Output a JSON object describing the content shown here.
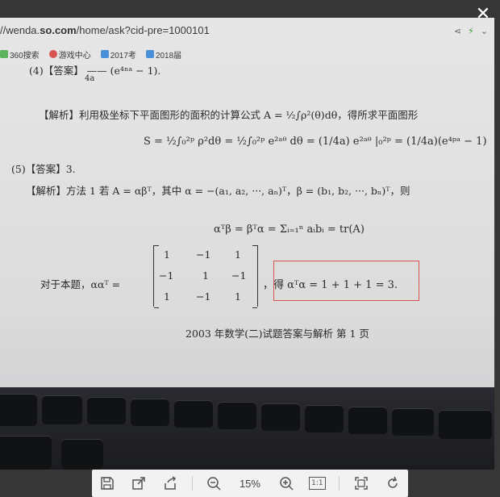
{
  "viewer": {
    "close_glyph": "✕",
    "zoom": "15%",
    "ratio_label": "1:1"
  },
  "browser": {
    "url_prefix": "//wenda.",
    "url_domain": "so.com",
    "url_path": "/home/ask?cid-pre=1000101",
    "bookmarks": [
      {
        "label": "360搜索",
        "color": "#5bb45b"
      },
      {
        "label": "游戏中心",
        "color": "#d9534f"
      },
      {
        "label": "2017考",
        "color": "#4a90d9"
      },
      {
        "label": "2018届",
        "color": "#4a90d9"
      }
    ]
  },
  "paper": {
    "line1": "(4)【答案】  —— (e⁴ⁿᵃ − 1).",
    "line1_frac": "4a",
    "line2": "【解析】利用极坐标下平面图形的面积的计算公式 A = ½∫ρ²(θ)dθ，得所求平面图形",
    "line3": "S = ½∫₀²ᵖ ρ²dθ = ½∫₀²ᵖ e²ᵃᶿ dθ = (1/4a) e²ᵃᶿ |₀²ᵖ = (1/4a)(e⁴ᵖᵃ − 1)",
    "line4": "(5)【答案】3.",
    "line5": "【解析】方法 1    若 A = αβᵀ，其中 α = −(a₁, a₂, ···, aₙ)ᵀ，β = (b₁, b₂, ···, bₙ)ᵀ，则",
    "line6": "αᵀβ = βᵀα = Σᵢ₌₁ⁿ aᵢbᵢ = tr(A)",
    "line7a": "对于本题，ααᵀ =",
    "matrix": [
      [
        "1",
        "−1",
        "1"
      ],
      [
        "−1",
        "1",
        "−1"
      ],
      [
        "1",
        "−1",
        "1"
      ]
    ],
    "line7b": "，得 αᵀα = 1 + 1 + 1 = 3.",
    "footer": "2003 年数学(二)试题答案与解析    第 1 页"
  }
}
